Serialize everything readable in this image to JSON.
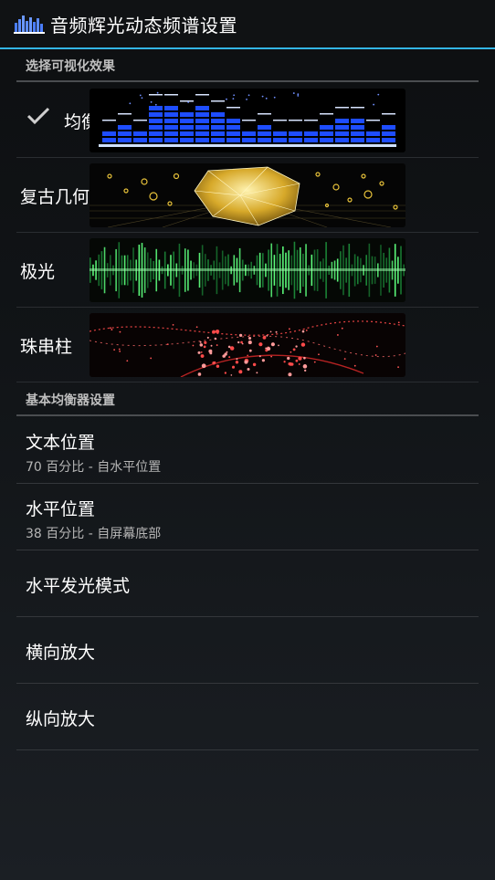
{
  "action_bar": {
    "title": "音频辉光动态频谱设置",
    "icon": "equalizer-app-icon"
  },
  "colors": {
    "accent": "#33b5e5",
    "eq_blue": "#1e4dff",
    "aurora_green": "#3dff6a",
    "bead_red": "#ff3b3b",
    "gold": "#e8c23a"
  },
  "visualization_section": {
    "header": "选择可视化效果",
    "items": [
      {
        "label": "均衡器",
        "selected": true,
        "preview": "equalizer-preview"
      },
      {
        "label": "复古几何",
        "selected": false,
        "preview": "retro-geometry-preview"
      },
      {
        "label": "极光",
        "selected": false,
        "preview": "aurora-preview"
      },
      {
        "label": "珠串柱",
        "selected": false,
        "preview": "bead-string-preview"
      }
    ]
  },
  "equalizer_section": {
    "header": "基本均衡器设置",
    "items": [
      {
        "title": "文本位置",
        "summary": "70 百分比 - 自水平位置"
      },
      {
        "title": "水平位置",
        "summary": "38 百分比 - 自屏幕底部"
      },
      {
        "title": "水平发光模式"
      },
      {
        "title": "横向放大"
      },
      {
        "title": "纵向放大"
      }
    ]
  }
}
